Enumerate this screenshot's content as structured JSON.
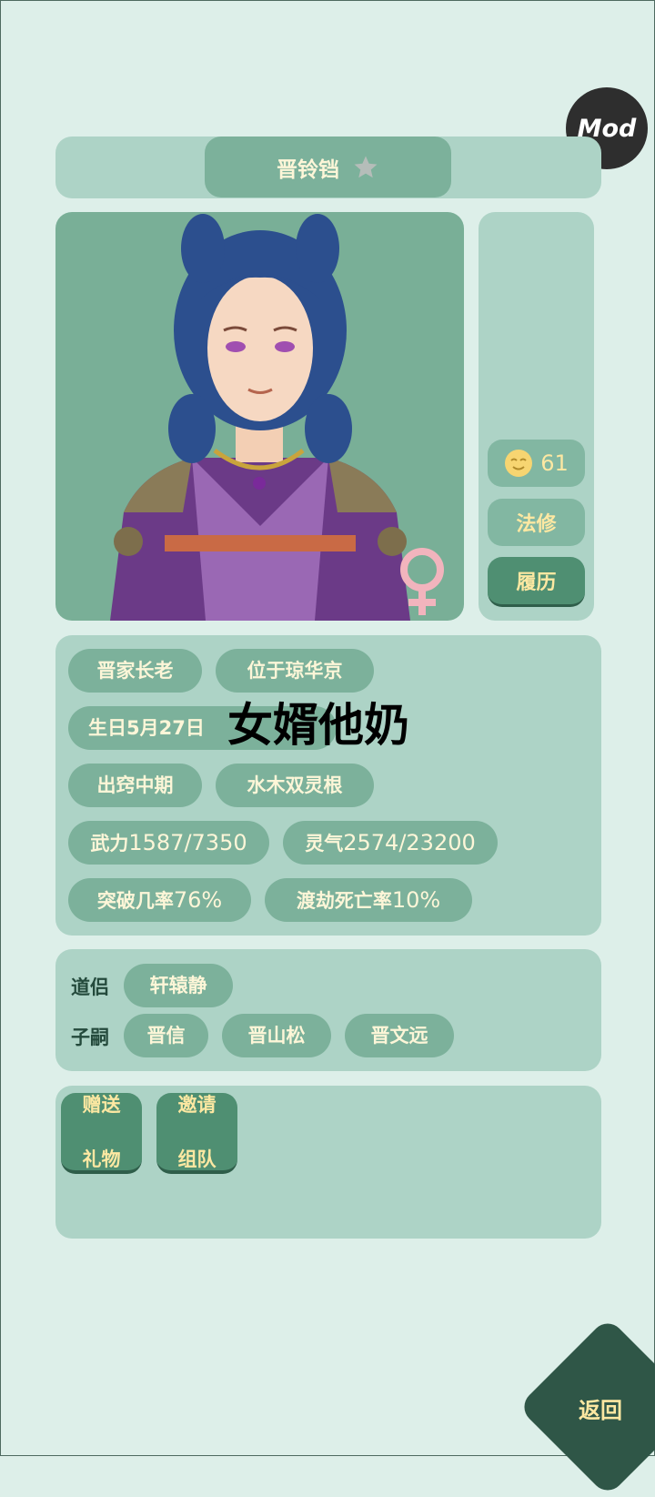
{
  "mod_label": "Mod",
  "character": {
    "name": "晋铃铛"
  },
  "side": {
    "mood_value": "61",
    "school": "法修",
    "resume": "履历"
  },
  "tags": {
    "title": "晋家长老",
    "location": "位于琼华京",
    "birthday": "生日5月27日",
    "stage": "出窍中期",
    "root": "水木双灵根",
    "force_label": "武力",
    "force_value": "1587/7350",
    "qi_label": "灵气",
    "qi_value": "2574/23200",
    "breakthrough_label": "突破几率",
    "breakthrough_value": "76%",
    "tribulation_label": "渡劫死亡率",
    "tribulation_value": "10%"
  },
  "overlay_text": "女婿他奶",
  "relations": {
    "partner_label": "道侣",
    "partner": "轩辕静",
    "children_label": "子嗣",
    "children": [
      "晋信",
      "晋山松",
      "晋文远"
    ]
  },
  "actions": {
    "gift_line1": "赠送",
    "gift_line2": "礼物",
    "invite_line1": "邀请",
    "invite_line2": "组队"
  },
  "back_label": "返回",
  "colors": {
    "background": "#ddefe9",
    "panel": "#add3c6",
    "tag": "#7cb19b",
    "button_dark": "#4f8f72",
    "accent_text": "#fde8a2",
    "female_sign": "#f2b4bd"
  }
}
